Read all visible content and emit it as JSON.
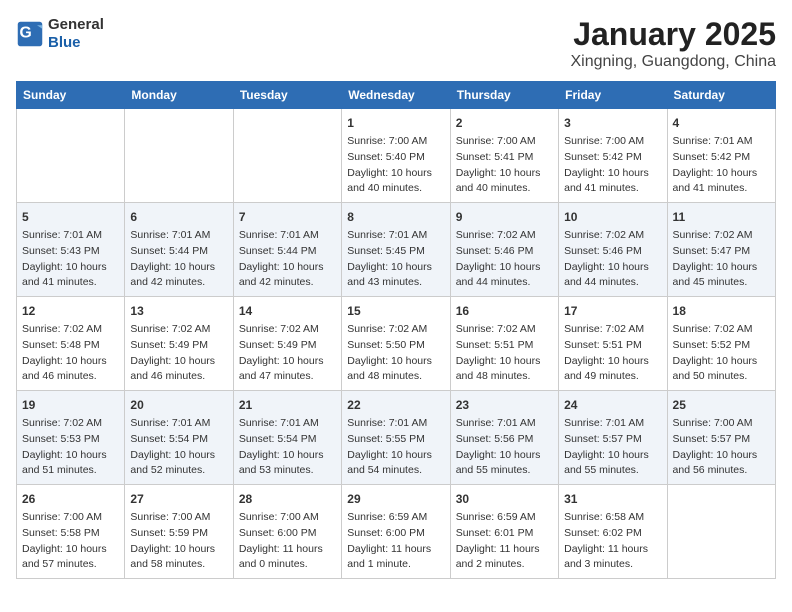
{
  "header": {
    "logo_general": "General",
    "logo_blue": "Blue",
    "title": "January 2025",
    "subtitle": "Xingning, Guangdong, China"
  },
  "calendar": {
    "days_of_week": [
      "Sunday",
      "Monday",
      "Tuesday",
      "Wednesday",
      "Thursday",
      "Friday",
      "Saturday"
    ],
    "weeks": [
      [
        {
          "day": "",
          "info": ""
        },
        {
          "day": "",
          "info": ""
        },
        {
          "day": "",
          "info": ""
        },
        {
          "day": "1",
          "info": "Sunrise: 7:00 AM\nSunset: 5:40 PM\nDaylight: 10 hours\nand 40 minutes."
        },
        {
          "day": "2",
          "info": "Sunrise: 7:00 AM\nSunset: 5:41 PM\nDaylight: 10 hours\nand 40 minutes."
        },
        {
          "day": "3",
          "info": "Sunrise: 7:00 AM\nSunset: 5:42 PM\nDaylight: 10 hours\nand 41 minutes."
        },
        {
          "day": "4",
          "info": "Sunrise: 7:01 AM\nSunset: 5:42 PM\nDaylight: 10 hours\nand 41 minutes."
        }
      ],
      [
        {
          "day": "5",
          "info": "Sunrise: 7:01 AM\nSunset: 5:43 PM\nDaylight: 10 hours\nand 41 minutes."
        },
        {
          "day": "6",
          "info": "Sunrise: 7:01 AM\nSunset: 5:44 PM\nDaylight: 10 hours\nand 42 minutes."
        },
        {
          "day": "7",
          "info": "Sunrise: 7:01 AM\nSunset: 5:44 PM\nDaylight: 10 hours\nand 42 minutes."
        },
        {
          "day": "8",
          "info": "Sunrise: 7:01 AM\nSunset: 5:45 PM\nDaylight: 10 hours\nand 43 minutes."
        },
        {
          "day": "9",
          "info": "Sunrise: 7:02 AM\nSunset: 5:46 PM\nDaylight: 10 hours\nand 44 minutes."
        },
        {
          "day": "10",
          "info": "Sunrise: 7:02 AM\nSunset: 5:46 PM\nDaylight: 10 hours\nand 44 minutes."
        },
        {
          "day": "11",
          "info": "Sunrise: 7:02 AM\nSunset: 5:47 PM\nDaylight: 10 hours\nand 45 minutes."
        }
      ],
      [
        {
          "day": "12",
          "info": "Sunrise: 7:02 AM\nSunset: 5:48 PM\nDaylight: 10 hours\nand 46 minutes."
        },
        {
          "day": "13",
          "info": "Sunrise: 7:02 AM\nSunset: 5:49 PM\nDaylight: 10 hours\nand 46 minutes."
        },
        {
          "day": "14",
          "info": "Sunrise: 7:02 AM\nSunset: 5:49 PM\nDaylight: 10 hours\nand 47 minutes."
        },
        {
          "day": "15",
          "info": "Sunrise: 7:02 AM\nSunset: 5:50 PM\nDaylight: 10 hours\nand 48 minutes."
        },
        {
          "day": "16",
          "info": "Sunrise: 7:02 AM\nSunset: 5:51 PM\nDaylight: 10 hours\nand 48 minutes."
        },
        {
          "day": "17",
          "info": "Sunrise: 7:02 AM\nSunset: 5:51 PM\nDaylight: 10 hours\nand 49 minutes."
        },
        {
          "day": "18",
          "info": "Sunrise: 7:02 AM\nSunset: 5:52 PM\nDaylight: 10 hours\nand 50 minutes."
        }
      ],
      [
        {
          "day": "19",
          "info": "Sunrise: 7:02 AM\nSunset: 5:53 PM\nDaylight: 10 hours\nand 51 minutes."
        },
        {
          "day": "20",
          "info": "Sunrise: 7:01 AM\nSunset: 5:54 PM\nDaylight: 10 hours\nand 52 minutes."
        },
        {
          "day": "21",
          "info": "Sunrise: 7:01 AM\nSunset: 5:54 PM\nDaylight: 10 hours\nand 53 minutes."
        },
        {
          "day": "22",
          "info": "Sunrise: 7:01 AM\nSunset: 5:55 PM\nDaylight: 10 hours\nand 54 minutes."
        },
        {
          "day": "23",
          "info": "Sunrise: 7:01 AM\nSunset: 5:56 PM\nDaylight: 10 hours\nand 55 minutes."
        },
        {
          "day": "24",
          "info": "Sunrise: 7:01 AM\nSunset: 5:57 PM\nDaylight: 10 hours\nand 55 minutes."
        },
        {
          "day": "25",
          "info": "Sunrise: 7:00 AM\nSunset: 5:57 PM\nDaylight: 10 hours\nand 56 minutes."
        }
      ],
      [
        {
          "day": "26",
          "info": "Sunrise: 7:00 AM\nSunset: 5:58 PM\nDaylight: 10 hours\nand 57 minutes."
        },
        {
          "day": "27",
          "info": "Sunrise: 7:00 AM\nSunset: 5:59 PM\nDaylight: 10 hours\nand 58 minutes."
        },
        {
          "day": "28",
          "info": "Sunrise: 7:00 AM\nSunset: 6:00 PM\nDaylight: 11 hours\nand 0 minutes."
        },
        {
          "day": "29",
          "info": "Sunrise: 6:59 AM\nSunset: 6:00 PM\nDaylight: 11 hours\nand 1 minute."
        },
        {
          "day": "30",
          "info": "Sunrise: 6:59 AM\nSunset: 6:01 PM\nDaylight: 11 hours\nand 2 minutes."
        },
        {
          "day": "31",
          "info": "Sunrise: 6:58 AM\nSunset: 6:02 PM\nDaylight: 11 hours\nand 3 minutes."
        },
        {
          "day": "",
          "info": ""
        }
      ]
    ]
  }
}
